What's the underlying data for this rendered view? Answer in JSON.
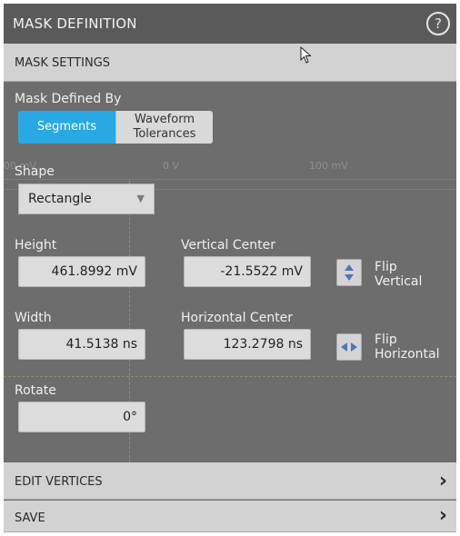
{
  "header": {
    "title": "MASK DEFINITION",
    "help_icon": "question-circle-icon"
  },
  "mask_settings": {
    "label": "MASK SETTINGS",
    "mask_defined_by": {
      "label": "Mask Defined By",
      "options": [
        "Segments",
        "Waveform\nTolerances"
      ],
      "selected": "Segments",
      "accent_color": "#29a9e4"
    },
    "shape": {
      "label": "Shape",
      "value": "Rectangle"
    },
    "height": {
      "label": "Height",
      "value": "461.8992 mV"
    },
    "vertical_center": {
      "label": "Vertical Center",
      "value": "-21.5522 mV"
    },
    "flip_vertical": {
      "label": "Flip\nVertical",
      "icon": "up-down-arrows-icon"
    },
    "width": {
      "label": "Width",
      "value": "41.5138 ns"
    },
    "horizontal_center": {
      "label": "Horizontal Center",
      "value": "123.2798 ns"
    },
    "flip_horizontal": {
      "label": "Flip\nHorizontal",
      "icon": "left-right-arrows-icon"
    },
    "rotate": {
      "label": "Rotate",
      "value": "0°"
    }
  },
  "background_waveform": {
    "labels": [
      "00 mV",
      "0 V",
      "100 mV"
    ]
  },
  "edit_vertices": {
    "label": "EDIT VERTICES"
  },
  "save": {
    "label": "SAVE"
  }
}
